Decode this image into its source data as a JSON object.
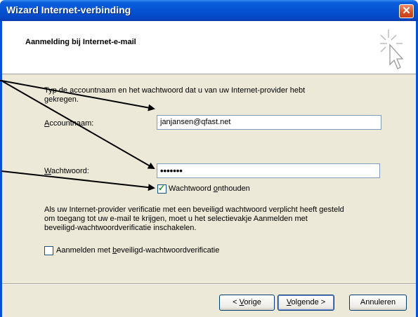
{
  "window": {
    "title": "Wizard Internet-verbinding",
    "close_icon": "close-icon"
  },
  "header": {
    "heading": "Aanmelding bij Internet-e-mail",
    "icon": "wizard-cursor-icon"
  },
  "intro": {
    "line1": "Typ de accountnaam en het wachtwoord dat u van uw Internet-provider hebt",
    "line2": "gekregen."
  },
  "account": {
    "label_pre": "",
    "label_u": "A",
    "label_rest": "ccountnaam:",
    "value": "janjansen@qfast.net"
  },
  "password": {
    "label_u": "W",
    "label_rest": "achtwoord:",
    "value": "•••••••"
  },
  "remember": {
    "label_pre": "Wachtwoord ",
    "label_u": "o",
    "label_rest": "nthouden",
    "checked": true
  },
  "spa_note": {
    "line1": "Als uw Internet-provider verificatie met een beveiligd wachtwoord verplicht heeft gesteld",
    "line2": "om toegang tot uw e-mail te krijgen, moet u het selectievakje Aanmelden met",
    "line3": "beveiligd-wachtwoordverificatie inschakelen."
  },
  "spa": {
    "label_pre": "Aanmelden met ",
    "label_u": "b",
    "label_rest": "eveiligd-wachtwoordverificatie",
    "checked": false
  },
  "buttons": {
    "back_pre": "< ",
    "back_u": "V",
    "back_rest": "orige",
    "next_u": "V",
    "next_rest": "olgende >",
    "cancel": "Annuleren"
  },
  "colors": {
    "titlebar": "#0553d3",
    "dialog_bg": "#ece9d8",
    "arrow": "#000000"
  }
}
